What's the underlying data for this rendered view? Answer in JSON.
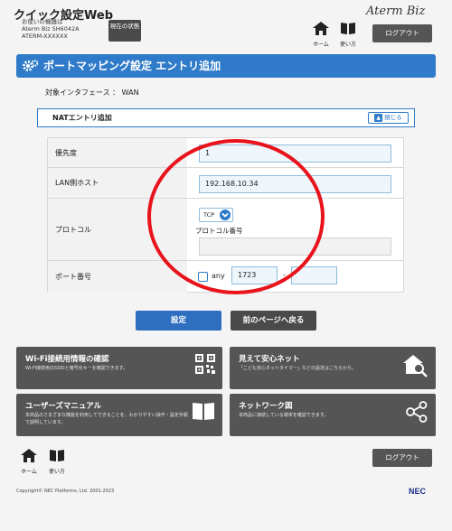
{
  "header": {
    "app_title": "クイック設定Web",
    "device_line1": "お使いの機器は",
    "device_line2": "Aterm Biz SH6042A",
    "device_line3": "ATERM-XXXXXX",
    "status_button": "現在の状態",
    "brand": "Aterm Biz",
    "home_label": "ホーム",
    "help_label": "使い方",
    "logout_label": "ログアウト"
  },
  "page": {
    "title": "ポートマッピング設定 エントリ追加",
    "interface_text": "対象インタフェース ： WAN"
  },
  "nat": {
    "section_title": "NATエントリ追加",
    "close_label": "閉じる",
    "priority_label": "優先度",
    "priority_value": "1",
    "lan_host_label": "LAN側ホスト",
    "lan_host_value": "192.168.10.34",
    "protocol_label": "プロトコル",
    "protocol_value": "TCP",
    "protocol_number_label": "プロトコル番号",
    "protocol_number_value": "",
    "port_label": "ポート番号",
    "any_label": "any",
    "port_from": "1723",
    "port_separator": "-",
    "port_to": ""
  },
  "actions": {
    "set_label": "設定",
    "back_label": "前のページへ戻る"
  },
  "cards": [
    {
      "title": "Wi-Fi接続用情報の確認",
      "desc": "Wi-Fi接続用のSSIDと暗号化キーを確認できます。"
    },
    {
      "title": "見えて安心ネット",
      "desc": "「こども安心ネットタイマー」などの設定はこちらから。"
    },
    {
      "title": "ユーザーズマニュアル",
      "desc": "本商品のさまざまな機能を利用してできることを、わかりやすい操作・設定手順で説明しています。"
    },
    {
      "title": "ネットワーク図",
      "desc": "本商品に接続している端末を確認できます。"
    }
  ],
  "footer": {
    "home_label": "ホーム",
    "help_label": "使い方",
    "logout_label": "ログアウト",
    "copyright": "Copyright© NEC Platforms, Ltd. 2001-2023",
    "nec_logo": "NEC"
  },
  "colors": {
    "accent": "#2f7bc9",
    "dark_button": "#4a4a4a",
    "annotation_ring": "#e8131b"
  }
}
